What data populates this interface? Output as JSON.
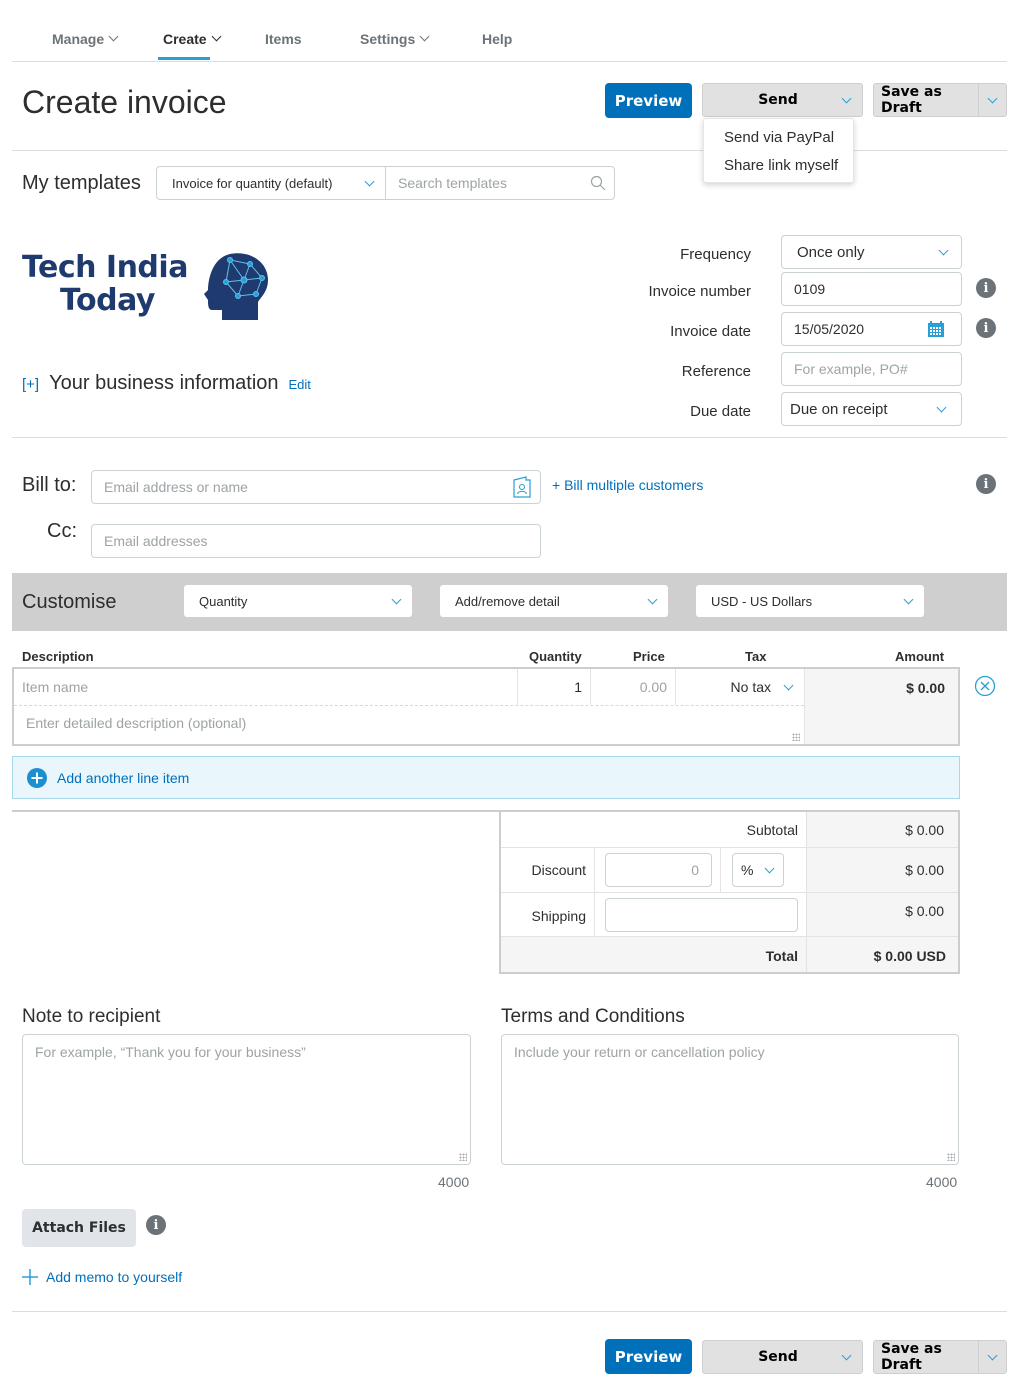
{
  "nav": {
    "items": [
      {
        "label": "Manage",
        "has_dropdown": true
      },
      {
        "label": "Create",
        "has_dropdown": true,
        "active": true
      },
      {
        "label": "Items",
        "has_dropdown": false
      },
      {
        "label": "Settings",
        "has_dropdown": true
      },
      {
        "label": "Help",
        "has_dropdown": false
      }
    ]
  },
  "header": {
    "title": "Create invoice",
    "preview_label": "Preview",
    "send_label": "Send",
    "save_draft_label": "Save as Draft"
  },
  "send_menu": {
    "items": [
      "Send via PayPal",
      "Share link myself"
    ]
  },
  "templates": {
    "label": "My templates",
    "selected": "Invoice for quantity (default)",
    "search_placeholder": "Search templates"
  },
  "business": {
    "logo_line1": "Tech India",
    "logo_line2": "Today",
    "expand_label": "[+]",
    "title": "Your business information",
    "edit_label": "Edit"
  },
  "invoice_fields": {
    "frequency_label": "Frequency",
    "frequency_value": "Once only",
    "number_label": "Invoice number",
    "number_value": "0109",
    "date_label": "Invoice date",
    "date_value": "15/05/2020",
    "reference_label": "Reference",
    "reference_placeholder": "For example, PO#",
    "due_label": "Due date",
    "due_value": "Due on receipt"
  },
  "bill": {
    "bill_to_label": "Bill to:",
    "bill_to_placeholder": "Email address or name",
    "multiple_label": "+ Bill multiple customers",
    "cc_label": "Cc:",
    "cc_placeholder": "Email addresses"
  },
  "customise": {
    "label": "Customise",
    "quantity_select": "Quantity",
    "detail_select": "Add/remove detail",
    "currency_select": "USD - US Dollars"
  },
  "line_items": {
    "columns": [
      "Description",
      "Quantity",
      "Price",
      "Tax",
      "Amount"
    ],
    "rows": [
      {
        "name_placeholder": "Item name",
        "quantity": "1",
        "price_placeholder": "0.00",
        "tax": "No tax",
        "amount": "$ 0.00",
        "description_placeholder": "Enter detailed description (optional)"
      }
    ],
    "add_label": "Add another line item"
  },
  "totals": {
    "subtotal_label": "Subtotal",
    "subtotal_value": "$ 0.00",
    "discount_label": "Discount",
    "discount_placeholder": "0",
    "discount_type": "%",
    "discount_value": "$ 0.00",
    "shipping_label": "Shipping",
    "shipping_value": "$ 0.00",
    "total_label": "Total",
    "total_value": "$ 0.00 USD"
  },
  "notes": {
    "note_title": "Note to recipient",
    "note_placeholder": "For example, “Thank you for your business”",
    "note_counter": "4000",
    "terms_title": "Terms and Conditions",
    "terms_placeholder": "Include your return or cancellation policy",
    "terms_counter": "4000"
  },
  "footer": {
    "attach_label": "Attach Files",
    "memo_label": "Add memo to yourself",
    "preview_label": "Preview",
    "send_label": "Send",
    "save_draft_label": "Save as Draft"
  },
  "colors": {
    "primary": "#0070ba",
    "accent": "#2a9fd6",
    "logo_navy": "#1f3a6e"
  }
}
